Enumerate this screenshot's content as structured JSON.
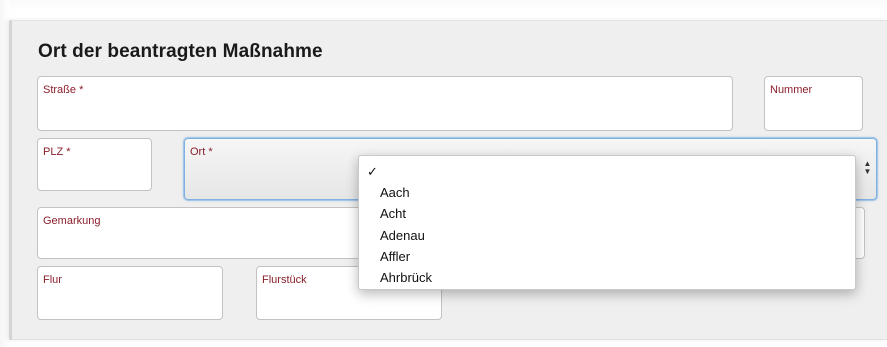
{
  "form": {
    "title": "Ort der beantragten Maßnahme",
    "fields": {
      "strasse": {
        "label": "Straße *",
        "value": ""
      },
      "nummer": {
        "label": "Nummer",
        "value": ""
      },
      "plz": {
        "label": "PLZ *",
        "value": ""
      },
      "ort": {
        "label": "Ort *",
        "value": ""
      },
      "gemarkung": {
        "label": "Gemarkung",
        "value": ""
      },
      "flur": {
        "label": "Flur",
        "value": ""
      },
      "flurstueck": {
        "label": "Flurstück",
        "value": ""
      }
    }
  },
  "ort_dropdown": {
    "selected_marker": "✓",
    "options": [
      "Aach",
      "Acht",
      "Adenau",
      "Affler",
      "Ahrbrück"
    ]
  },
  "icons": {
    "select_arrows": "up-down-arrows-icon",
    "check": "checkmark-icon"
  },
  "colors": {
    "label": "#8a1f2c",
    "panel_background": "#efefef",
    "focus_border": "#7fb2e3"
  }
}
